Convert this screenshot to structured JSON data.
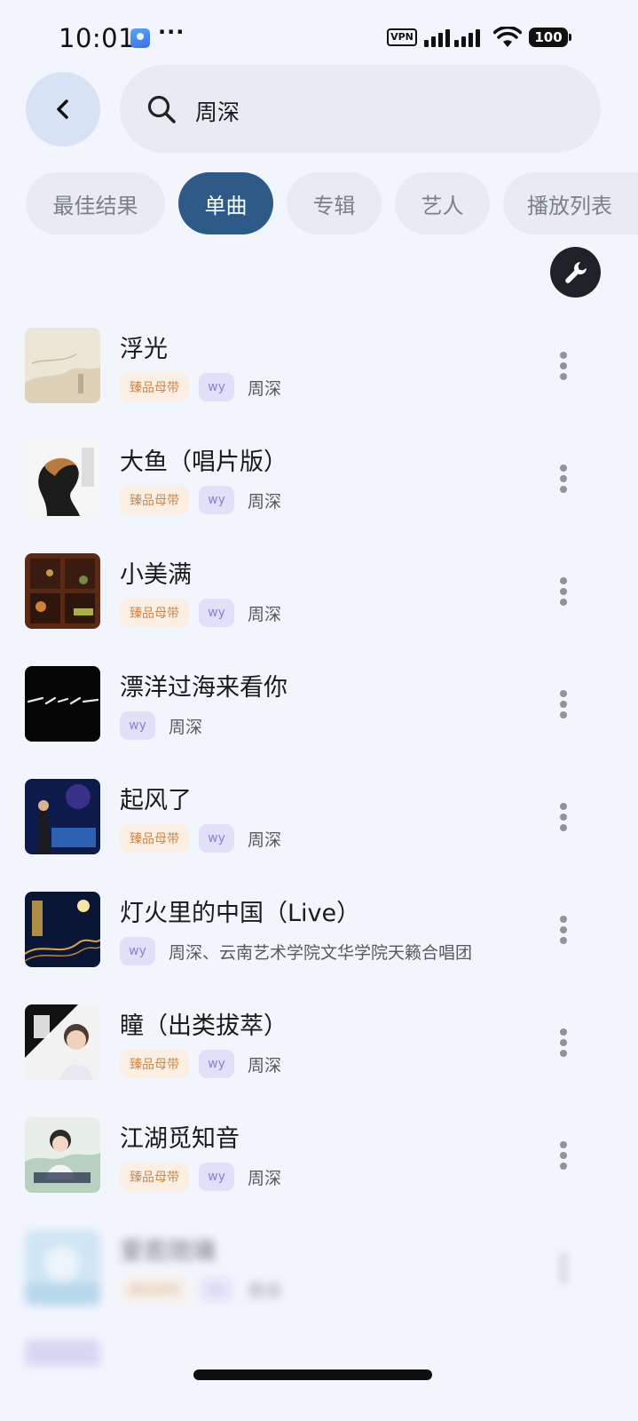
{
  "status_bar": {
    "time": "10:01",
    "dots": "···",
    "vpn": "VPN",
    "battery": "100"
  },
  "header": {
    "back_icon": "chevron-left-icon",
    "search_icon": "search-icon",
    "search_value": "周深"
  },
  "tabs": [
    {
      "label": "最佳结果",
      "active": false
    },
    {
      "label": "单曲",
      "active": true
    },
    {
      "label": "专辑",
      "active": false
    },
    {
      "label": "艺人",
      "active": false
    },
    {
      "label": "播放列表",
      "active": false
    }
  ],
  "tool_icon": "wrench-icon",
  "songs": [
    {
      "title": "浮光",
      "premium": "臻品母带",
      "source": "wy",
      "artist": "周深"
    },
    {
      "title": "大鱼（唱片版）",
      "premium": "臻品母带",
      "source": "wy",
      "artist": "周深"
    },
    {
      "title": "小美满",
      "premium": "臻品母带",
      "source": "wy",
      "artist": "周深"
    },
    {
      "title": "漂洋过海来看你",
      "premium": "",
      "source": "wy",
      "artist": "周深"
    },
    {
      "title": "起风了",
      "premium": "臻品母带",
      "source": "wy",
      "artist": "周深"
    },
    {
      "title": "灯火里的中国（Live）",
      "premium": "",
      "source": "wy",
      "artist": "周深、云南艺术学院文华学院天籁合唱团"
    },
    {
      "title": "瞳（出类拔萃）",
      "premium": "臻品母带",
      "source": "wy",
      "artist": "周深"
    },
    {
      "title": "江湖觅知音",
      "premium": "臻品母带",
      "source": "wy",
      "artist": "周深"
    },
    {
      "title": "爱若琉璃",
      "premium": "臻品母带",
      "source": "wy",
      "artist": "周深"
    }
  ],
  "colors": {
    "background": "#f3f5fc",
    "active_tab": "#2d5a86",
    "premium_badge_text": "#c8884f",
    "wy_badge_text": "#8b80d6"
  }
}
